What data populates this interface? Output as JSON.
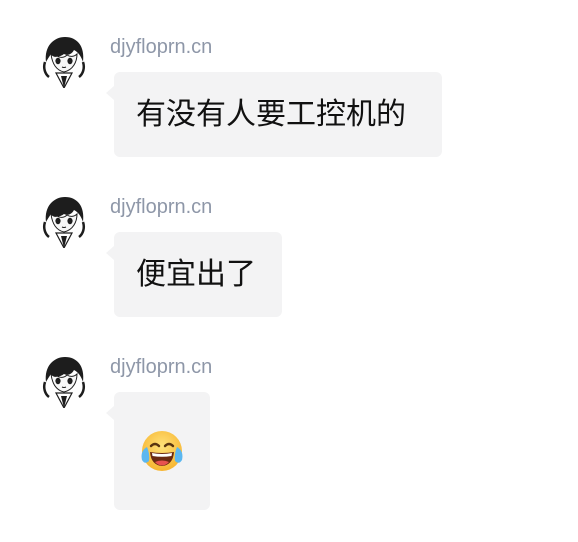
{
  "messages": [
    {
      "sender": "djyfloprn.cn",
      "text": "有没有人要工控机的",
      "type": "text",
      "avatar_icon": "anime-avatar-icon"
    },
    {
      "sender": "djyfloprn.cn",
      "text": "便宜出了",
      "type": "text",
      "avatar_icon": "anime-avatar-icon"
    },
    {
      "sender": "djyfloprn.cn",
      "text": "",
      "type": "emoji",
      "emoji_icon": "tears-of-joy-emoji-icon",
      "avatar_icon": "anime-avatar-icon"
    }
  ],
  "colors": {
    "sender_name": "#8e97a8",
    "bubble_background": "#f3f3f4",
    "message_text": "#111111",
    "page_background": "#ffffff"
  }
}
